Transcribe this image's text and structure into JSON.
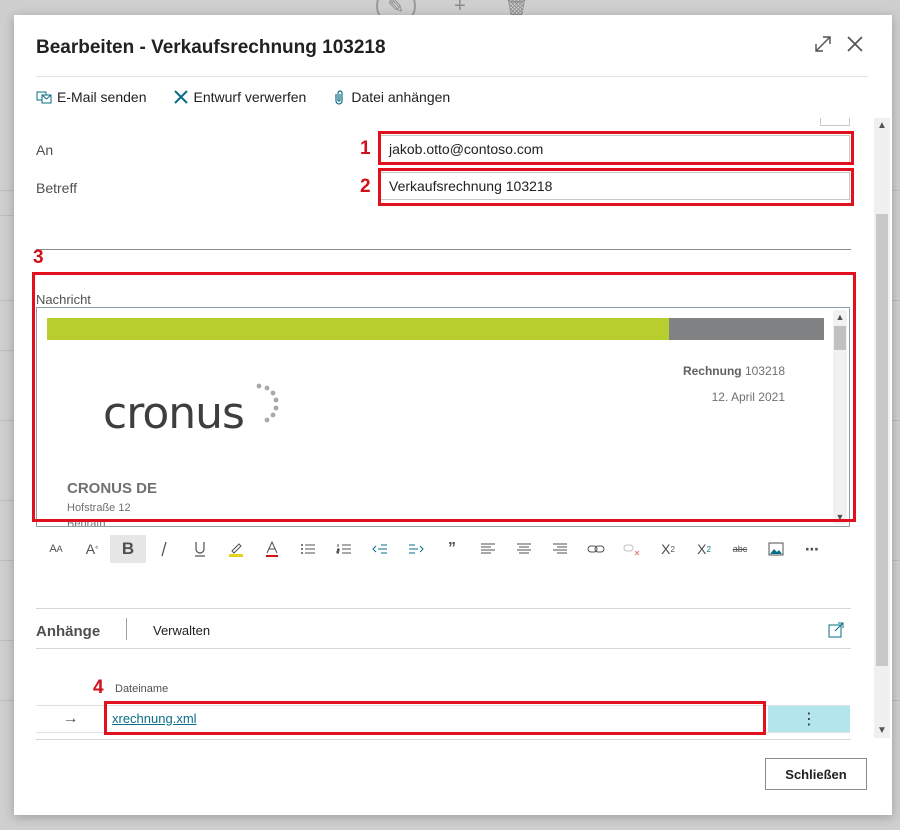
{
  "dialog": {
    "title": "Bearbeiten - Verkaufsrechnung 103218"
  },
  "actions": {
    "send_email": "E-Mail senden",
    "discard_draft": "Entwurf verwerfen",
    "attach_file": "Datei anhängen"
  },
  "fields": {
    "to_label": "An",
    "to_value": "jakob.otto@contoso.com",
    "subject_label": "Betreff",
    "subject_value": "Verkaufsrechnung 103218"
  },
  "markers": {
    "m1": "1",
    "m2": "2",
    "m3": "3",
    "m4": "4"
  },
  "message": {
    "label": "Nachricht",
    "logo_text": "cronus",
    "invoice_label": "Rechnung",
    "invoice_number": "103218",
    "invoice_date": "12. April 2021",
    "company": "CRONUS DE",
    "street": "Hofstraße 12",
    "city": "Benrath"
  },
  "toolbar": [
    "font-size-icon",
    "font-grow-icon",
    "bold-icon",
    "italic-icon",
    "underline-icon",
    "highlight-icon",
    "font-color-icon",
    "bullet-list-icon",
    "numbered-list-icon",
    "outdent-icon",
    "indent-icon",
    "quote-icon",
    "align-left-icon",
    "align-center-icon",
    "align-right-icon",
    "link-icon",
    "unlink-icon",
    "superscript-icon",
    "subscript-icon",
    "strikethrough-icon",
    "image-icon",
    "more-icon"
  ],
  "attachments": {
    "title": "Anhänge",
    "manage": "Verwalten",
    "column_filename": "Dateiname",
    "rows": [
      {
        "filename": "xrechnung.xml"
      }
    ]
  },
  "footer": {
    "close_label": "Schließen"
  },
  "colors": {
    "accent": "#0a6e86",
    "highlight_red": "#e0111c",
    "bar_green": "#b8cd2e",
    "bar_gray": "#808284",
    "row_selected": "#b3e6ec"
  }
}
